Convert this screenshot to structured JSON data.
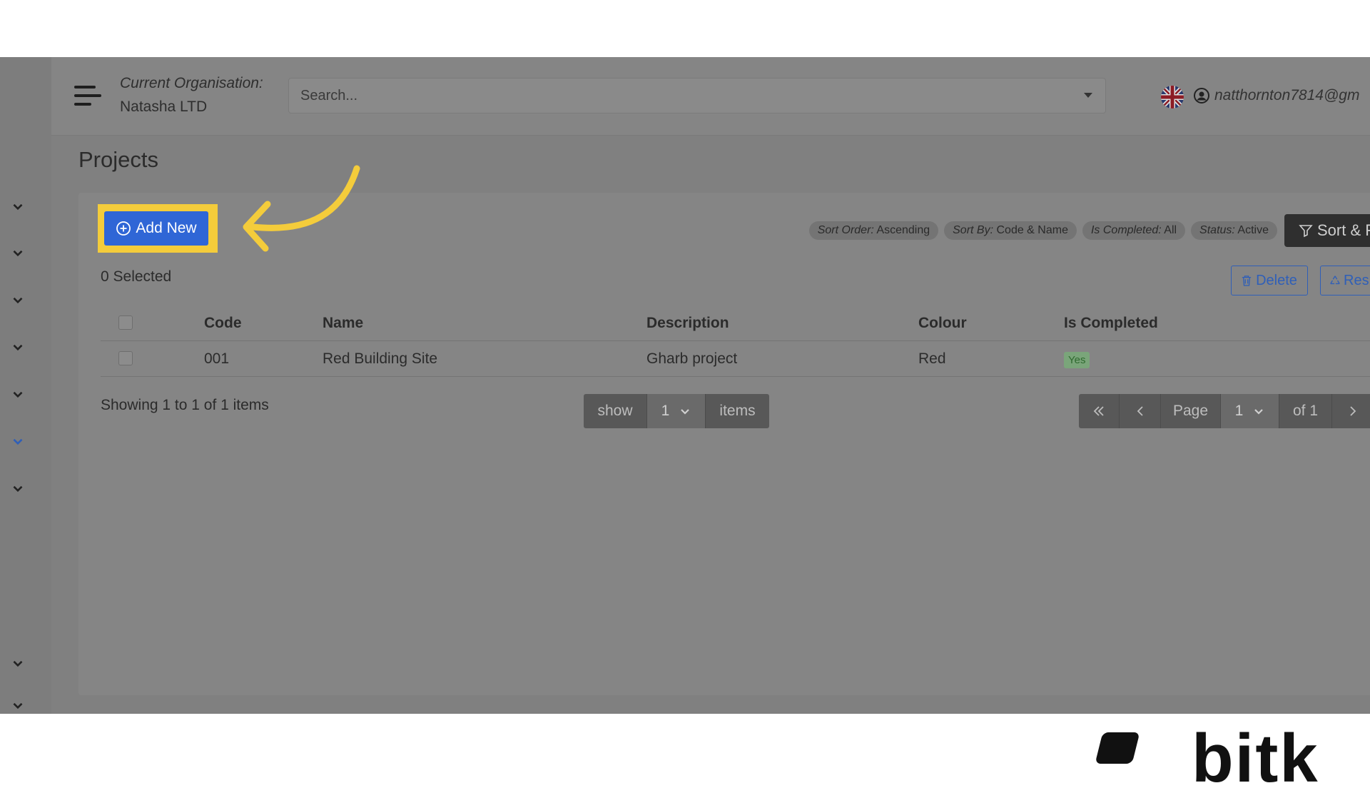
{
  "header": {
    "org_label": "Current Organisation:",
    "org_name": "Natasha LTD",
    "search_placeholder": "Search...",
    "user_email": "natthornton7814@gm"
  },
  "page": {
    "title": "Projects"
  },
  "toolbar": {
    "add_label": "Add New",
    "chips": [
      {
        "key": "Sort Order:",
        "value": "Ascending"
      },
      {
        "key": "Sort By:",
        "value": "Code & Name"
      },
      {
        "key": "Is Completed:",
        "value": "All"
      },
      {
        "key": "Status:",
        "value": "Active"
      }
    ],
    "sort_label": "Sort & F",
    "selected_text": "0 Selected",
    "delete_label": "Delete",
    "restore_label": "Res"
  },
  "table": {
    "headers": [
      "Code",
      "Name",
      "Description",
      "Colour",
      "Is Completed"
    ],
    "rows": [
      {
        "code": "001",
        "name": "Red Building Site",
        "description": "Gharb project",
        "colour": "Red",
        "is_completed": "Yes"
      }
    ]
  },
  "pagination": {
    "showing_text": "Showing 1 to 1 of 1 items",
    "show_label": "show",
    "page_size": "1",
    "items_label": "items",
    "page_label": "Page",
    "current_page": "1",
    "of_label": "of 1"
  },
  "branding": {
    "logo_text": "bitk"
  },
  "colors": {
    "highlight": "#f4cc3b",
    "primary": "#2f66d6",
    "overlay": "#808080"
  }
}
